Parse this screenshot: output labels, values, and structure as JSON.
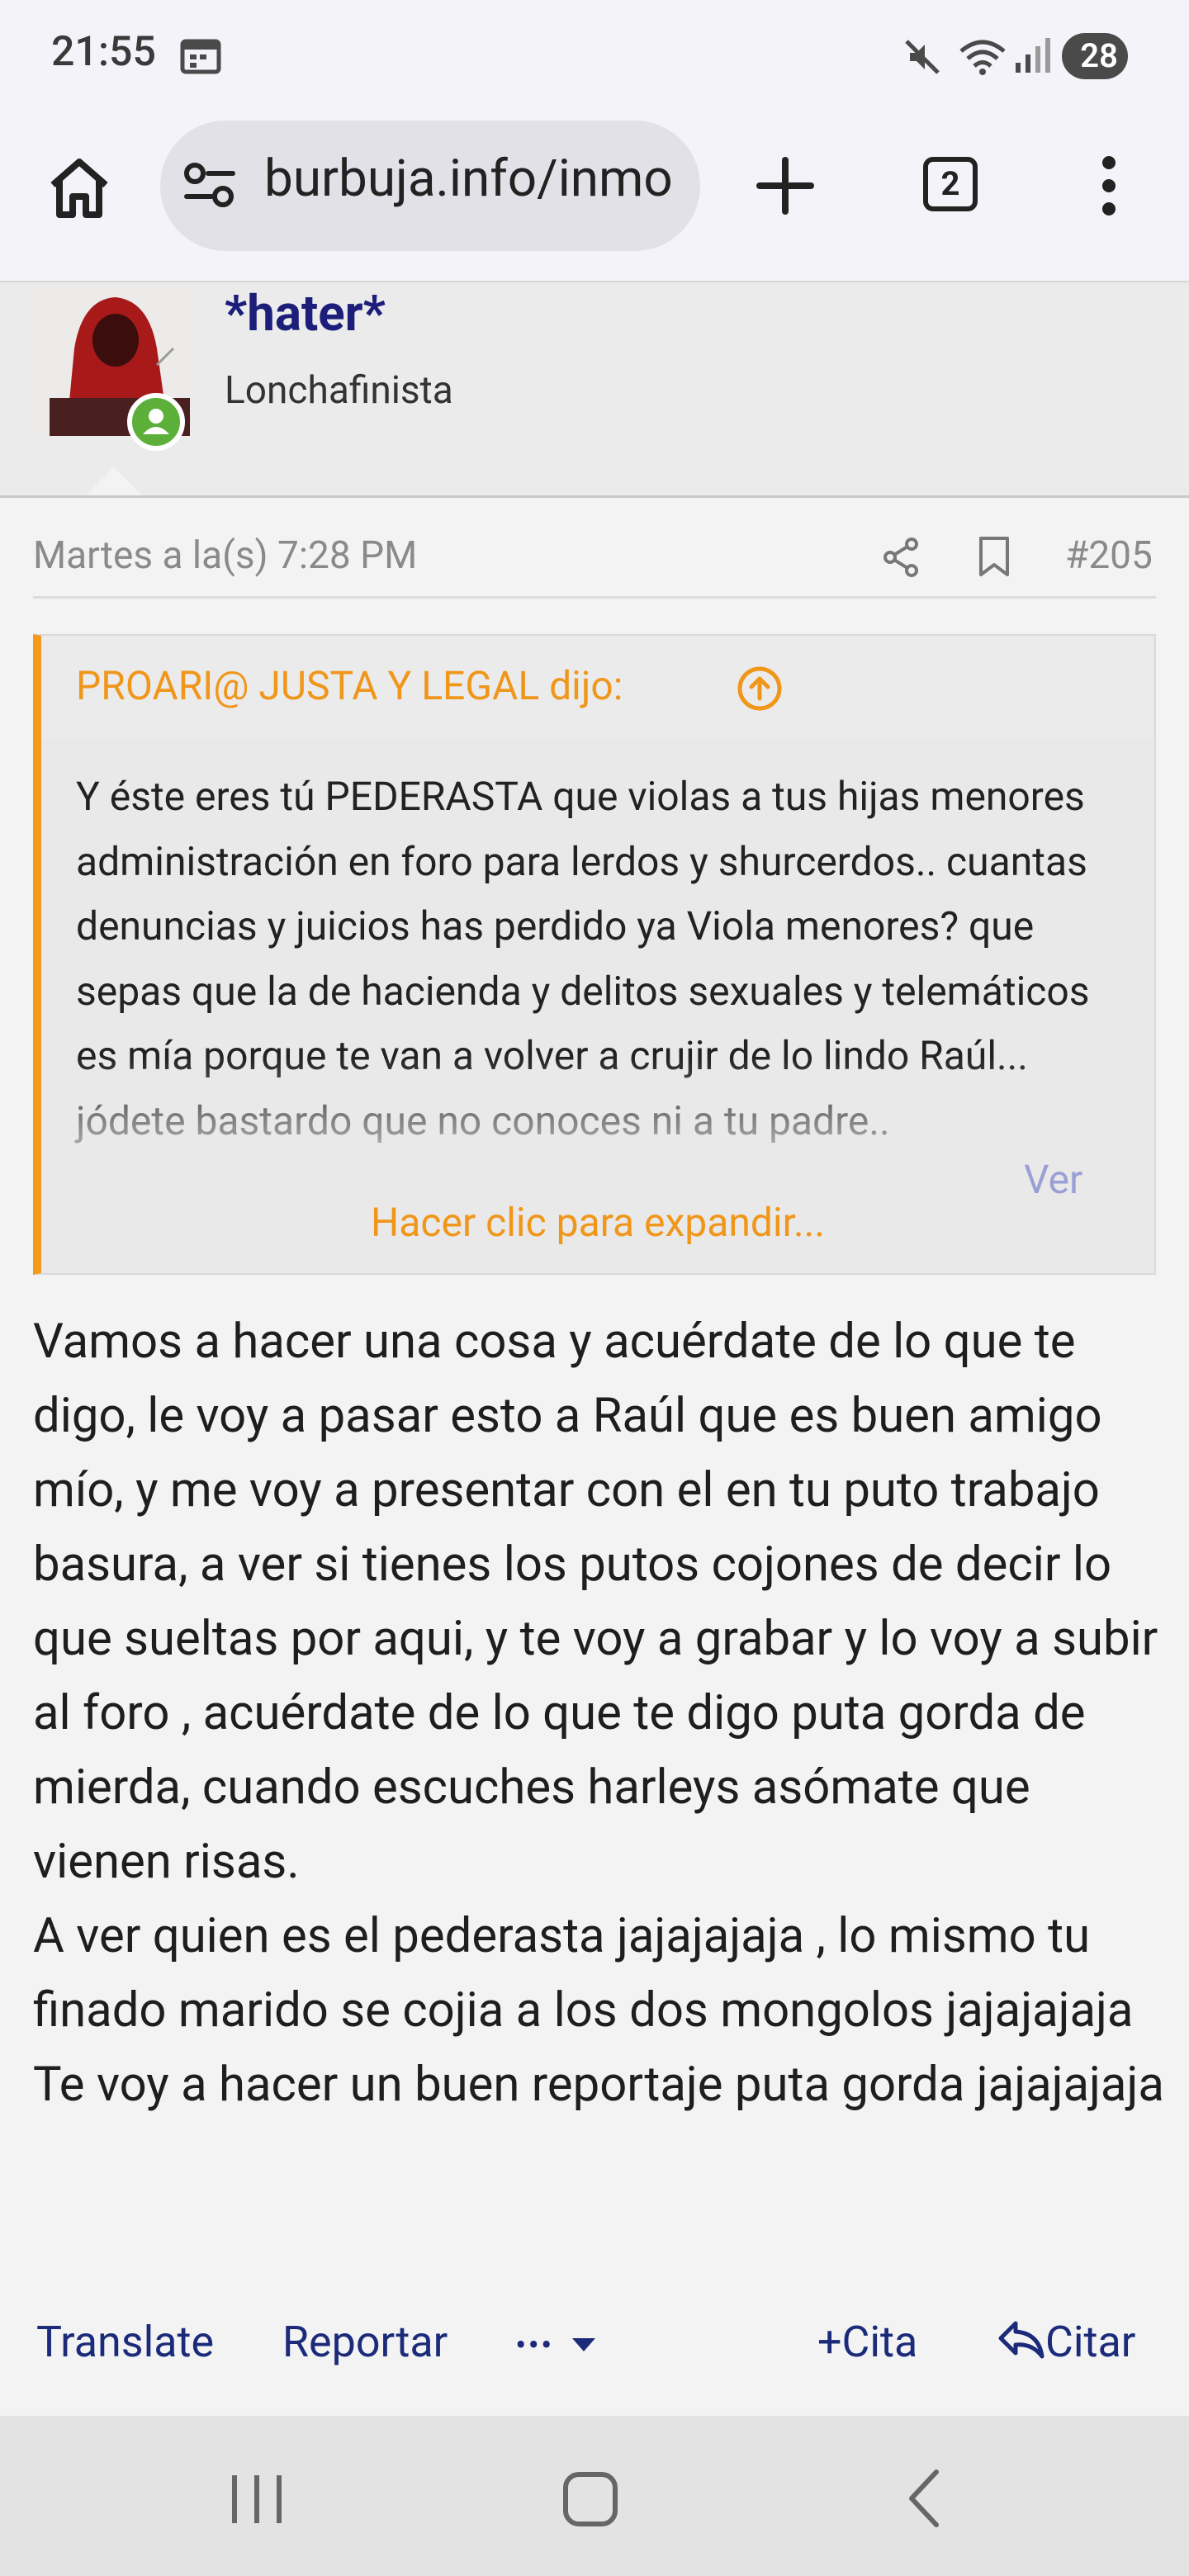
{
  "status_bar": {
    "time": "21:55",
    "battery": "28"
  },
  "browser": {
    "url": "burbuja.info/inmo",
    "tab_count": "2"
  },
  "post": {
    "username": "*hater*",
    "user_title": "Lonchafinista",
    "date": "Martes a la(s) 7:28 PM",
    "number": "#205",
    "quote": {
      "author": "PROARI@ JUSTA Y LEGAL dijo:",
      "text": "Y éste eres tú PEDERASTA que violas a tus hijas menores administración en foro para lerdos y shurcerdos.. cuantas denuncias y juicios has perdido ya Viola menores? que sepas que la de hacienda y delitos sexuales y telemáticos es mía porque te van a volver a crujir de lo lindo Raúl... jódete bastardo que no conoces ni a tu padre..",
      "read_more": "Ver",
      "expand": "Hacer clic para expandir..."
    },
    "body": [
      "Vamos a hacer una cosa y acuérdate de lo que te digo, le voy a pasar esto a Raúl que es buen amigo mío, y me voy a presentar con el en tu puto trabajo basura, a ver si tienes los putos cojones de decir lo que sueltas por aqui, y te voy a grabar y lo voy a subir al foro , acuérdate de lo que te digo puta gorda de mierda, cuando escuches harleys asómate que vienen risas.",
      "A ver quien es el pederasta jajajajaja , lo mismo tu finado marido se cojia a los dos mongolos jajajajaja",
      "Te voy a hacer un buen reportaje puta gorda jajajajaja"
    ],
    "actions": {
      "translate": "Translate",
      "report": "Reportar",
      "more": "•••",
      "add_quote": "Cita",
      "reply": "Citar"
    }
  },
  "colors": {
    "accent": "#f39a1a",
    "link": "#1c2a7a",
    "online": "#5cb03a"
  }
}
